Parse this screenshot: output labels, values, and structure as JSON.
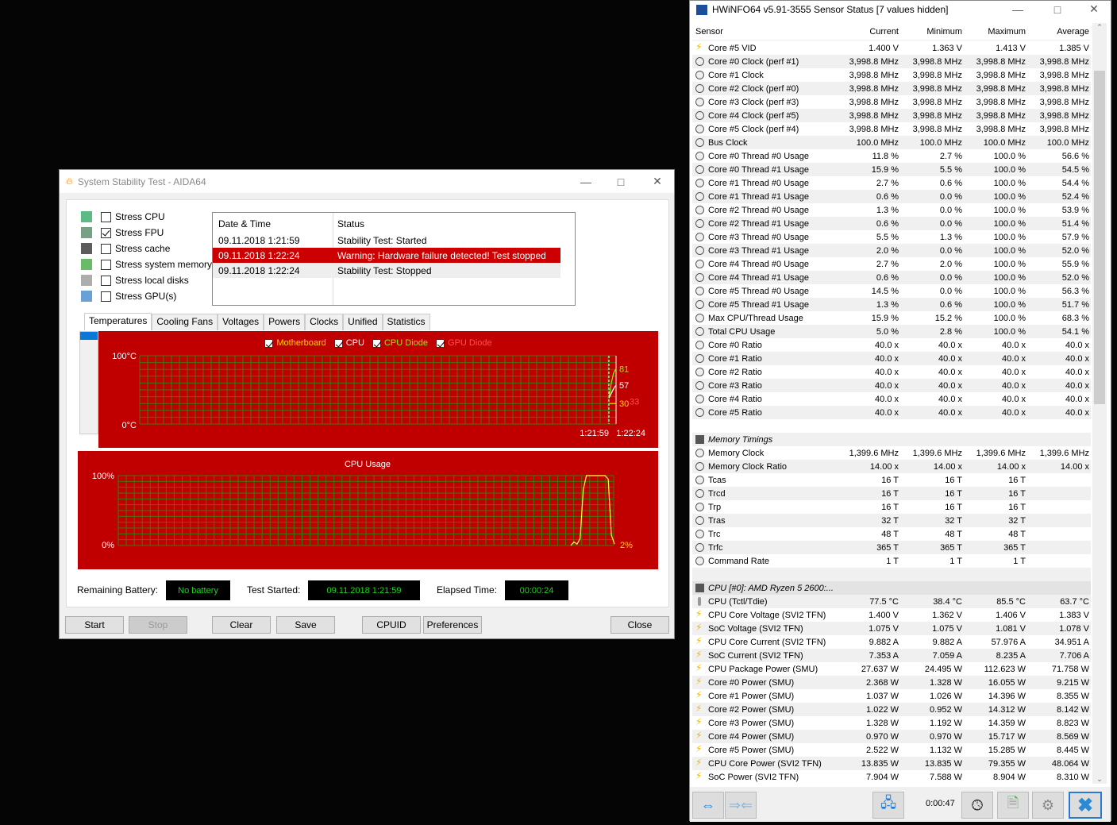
{
  "aida": {
    "title": "System Stability Test - AIDA64",
    "options": [
      {
        "label": "Stress CPU",
        "checked": false
      },
      {
        "label": "Stress FPU",
        "checked": true
      },
      {
        "label": "Stress cache",
        "checked": false
      },
      {
        "label": "Stress system memory",
        "checked": false
      },
      {
        "label": "Stress local disks",
        "checked": false
      },
      {
        "label": "Stress GPU(s)",
        "checked": false
      }
    ],
    "log": {
      "headers": [
        "Date & Time",
        "Status"
      ],
      "rows": [
        [
          "09.11.2018 1:21:59",
          "Stability Test: Started"
        ],
        [
          "09.11.2018 1:22:24",
          "Warning: Hardware failure detected! Test stopped"
        ],
        [
          "09.11.2018 1:22:24",
          "Stability Test: Stopped"
        ]
      ]
    },
    "tabs": [
      "Temperatures",
      "Cooling Fans",
      "Voltages",
      "Powers",
      "Clocks",
      "Unified",
      "Statistics"
    ],
    "battery_label": "Remaining Battery:",
    "battery_value": "No battery",
    "started_label": "Test Started:",
    "started_value": "09.11.2018 1:21:59",
    "elapsed_label": "Elapsed Time:",
    "elapsed_value": "00:00:24",
    "buttons": [
      "Start",
      "Stop",
      "Clear",
      "Save",
      "CPUID",
      "Preferences",
      "Close"
    ]
  },
  "chart_data": [
    {
      "type": "line",
      "title": "Temperatures",
      "legend": [
        {
          "name": "Motherboard",
          "color": "#ffd700"
        },
        {
          "name": "CPU",
          "color": "#ffffff"
        },
        {
          "name": "CPU Diode",
          "color": "#7cfc00"
        },
        {
          "name": "GPU Diode",
          "color": "#ff5050"
        }
      ],
      "ylim": [
        0,
        100
      ],
      "ytick_labels": [
        "100°C",
        "0°C"
      ],
      "xtick_labels": [
        "1:21:59",
        "1:22:24"
      ],
      "value_labels": [
        {
          "text": "81",
          "value": 81,
          "color": "#7cfc00"
        },
        {
          "text": "57",
          "value": 57,
          "color": "#ffffff"
        },
        {
          "text": "30",
          "value": 30,
          "color": "#ffd700"
        },
        {
          "text": "33",
          "value": 33,
          "color": "#ff5050"
        }
      ],
      "series": [
        {
          "name": "CPU Diode",
          "values": [
            38,
            60,
            75,
            81
          ]
        },
        {
          "name": "CPU",
          "values": [
            38,
            45,
            52,
            57
          ]
        },
        {
          "name": "Motherboard",
          "values": [
            30,
            30,
            30,
            30
          ]
        }
      ]
    },
    {
      "type": "line",
      "title": "CPU Usage",
      "ylim": [
        0,
        100
      ],
      "ytick_labels": [
        "100%",
        "0%"
      ],
      "value_label": "2%",
      "series": [
        {
          "name": "CPU Usage",
          "values": [
            0,
            5,
            2,
            10,
            80,
            100,
            100,
            100,
            100,
            100,
            100,
            100,
            95,
            15,
            2
          ]
        }
      ]
    }
  ],
  "hw": {
    "title": "HWiNFO64 v5.91-3555 Sensor Status [7 values hidden]",
    "headers": [
      "Sensor",
      "Current",
      "Minimum",
      "Maximum",
      "Average"
    ],
    "rows": [
      [
        "bolt",
        "Core #5 VID",
        "1.400 V",
        "1.363 V",
        "1.413 V",
        "1.385 V"
      ],
      [
        "clock",
        "Core #0 Clock (perf #1)",
        "3,998.8 MHz",
        "3,998.8 MHz",
        "3,998.8 MHz",
        "3,998.8 MHz"
      ],
      [
        "clock",
        "Core #1 Clock",
        "3,998.8 MHz",
        "3,998.8 MHz",
        "3,998.8 MHz",
        "3,998.8 MHz"
      ],
      [
        "clock",
        "Core #2 Clock (perf #0)",
        "3,998.8 MHz",
        "3,998.8 MHz",
        "3,998.8 MHz",
        "3,998.8 MHz"
      ],
      [
        "clock",
        "Core #3 Clock (perf #3)",
        "3,998.8 MHz",
        "3,998.8 MHz",
        "3,998.8 MHz",
        "3,998.8 MHz"
      ],
      [
        "clock",
        "Core #4 Clock (perf #5)",
        "3,998.8 MHz",
        "3,998.8 MHz",
        "3,998.8 MHz",
        "3,998.8 MHz"
      ],
      [
        "clock",
        "Core #5 Clock (perf #4)",
        "3,998.8 MHz",
        "3,998.8 MHz",
        "3,998.8 MHz",
        "3,998.8 MHz"
      ],
      [
        "clock",
        "Bus Clock",
        "100.0 MHz",
        "100.0 MHz",
        "100.0 MHz",
        "100.0 MHz"
      ],
      [
        "clock",
        "Core #0 Thread #0 Usage",
        "11.8 %",
        "2.7 %",
        "100.0 %",
        "56.6 %"
      ],
      [
        "clock",
        "Core #0 Thread #1 Usage",
        "15.9 %",
        "5.5 %",
        "100.0 %",
        "54.5 %"
      ],
      [
        "clock",
        "Core #1 Thread #0 Usage",
        "2.7 %",
        "0.6 %",
        "100.0 %",
        "54.4 %"
      ],
      [
        "clock",
        "Core #1 Thread #1 Usage",
        "0.6 %",
        "0.0 %",
        "100.0 %",
        "52.4 %"
      ],
      [
        "clock",
        "Core #2 Thread #0 Usage",
        "1.3 %",
        "0.0 %",
        "100.0 %",
        "53.9 %"
      ],
      [
        "clock",
        "Core #2 Thread #1 Usage",
        "0.6 %",
        "0.0 %",
        "100.0 %",
        "51.4 %"
      ],
      [
        "clock",
        "Core #3 Thread #0 Usage",
        "5.5 %",
        "1.3 %",
        "100.0 %",
        "57.9 %"
      ],
      [
        "clock",
        "Core #3 Thread #1 Usage",
        "2.0 %",
        "0.0 %",
        "100.0 %",
        "52.0 %"
      ],
      [
        "clock",
        "Core #4 Thread #0 Usage",
        "2.7 %",
        "2.0 %",
        "100.0 %",
        "55.9 %"
      ],
      [
        "clock",
        "Core #4 Thread #1 Usage",
        "0.6 %",
        "0.0 %",
        "100.0 %",
        "52.0 %"
      ],
      [
        "clock",
        "Core #5 Thread #0 Usage",
        "14.5 %",
        "0.0 %",
        "100.0 %",
        "56.3 %"
      ],
      [
        "clock",
        "Core #5 Thread #1 Usage",
        "1.3 %",
        "0.6 %",
        "100.0 %",
        "51.7 %"
      ],
      [
        "clock",
        "Max CPU/Thread Usage",
        "15.9 %",
        "15.2 %",
        "100.0 %",
        "68.3 %"
      ],
      [
        "clock",
        "Total CPU Usage",
        "5.0 %",
        "2.8 %",
        "100.0 %",
        "54.1 %"
      ],
      [
        "clock",
        "Core #0 Ratio",
        "40.0 x",
        "40.0 x",
        "40.0 x",
        "40.0 x"
      ],
      [
        "clock",
        "Core #1 Ratio",
        "40.0 x",
        "40.0 x",
        "40.0 x",
        "40.0 x"
      ],
      [
        "clock",
        "Core #2 Ratio",
        "40.0 x",
        "40.0 x",
        "40.0 x",
        "40.0 x"
      ],
      [
        "clock",
        "Core #3 Ratio",
        "40.0 x",
        "40.0 x",
        "40.0 x",
        "40.0 x"
      ],
      [
        "clock",
        "Core #4 Ratio",
        "40.0 x",
        "40.0 x",
        "40.0 x",
        "40.0 x"
      ],
      [
        "clock",
        "Core #5 Ratio",
        "40.0 x",
        "40.0 x",
        "40.0 x",
        "40.0 x"
      ],
      [
        "blank",
        "",
        "",
        "",
        "",
        ""
      ],
      [
        "section",
        "Memory Timings",
        "",
        "",
        "",
        ""
      ],
      [
        "clock",
        "Memory Clock",
        "1,399.6 MHz",
        "1,399.6 MHz",
        "1,399.6 MHz",
        "1,399.6 MHz"
      ],
      [
        "clock",
        "Memory Clock Ratio",
        "14.00 x",
        "14.00 x",
        "14.00 x",
        "14.00 x"
      ],
      [
        "clock",
        "Tcas",
        "16 T",
        "16 T",
        "16 T",
        ""
      ],
      [
        "clock",
        "Trcd",
        "16 T",
        "16 T",
        "16 T",
        ""
      ],
      [
        "clock",
        "Trp",
        "16 T",
        "16 T",
        "16 T",
        ""
      ],
      [
        "clock",
        "Tras",
        "32 T",
        "32 T",
        "32 T",
        ""
      ],
      [
        "clock",
        "Trc",
        "48 T",
        "48 T",
        "48 T",
        ""
      ],
      [
        "clock",
        "Trfc",
        "365 T",
        "365 T",
        "365 T",
        ""
      ],
      [
        "clock",
        "Command Rate",
        "1 T",
        "1 T",
        "1 T",
        ""
      ],
      [
        "blank",
        "",
        "",
        "",
        "",
        ""
      ],
      [
        "section",
        "CPU [#0]: AMD Ryzen 5 2600:...",
        "",
        "",
        "",
        ""
      ],
      [
        "thermo",
        "CPU (Tctl/Tdie)",
        "77.5 °C",
        "38.4 °C",
        "85.5 °C",
        "63.7 °C"
      ],
      [
        "bolt",
        "CPU Core Voltage (SVI2 TFN)",
        "1.400 V",
        "1.362 V",
        "1.406 V",
        "1.383 V"
      ],
      [
        "bolt",
        "SoC Voltage (SVI2 TFN)",
        "1.075 V",
        "1.075 V",
        "1.081 V",
        "1.078 V"
      ],
      [
        "bolt",
        "CPU Core Current (SVI2 TFN)",
        "9.882 A",
        "9.882 A",
        "57.976 A",
        "34.951 A"
      ],
      [
        "bolt",
        "SoC Current (SVI2 TFN)",
        "7.353 A",
        "7.059 A",
        "8.235 A",
        "7.706 A"
      ],
      [
        "bolt",
        "CPU Package Power (SMU)",
        "27.637 W",
        "24.495 W",
        "112.623 W",
        "71.758 W"
      ],
      [
        "bolt",
        "Core #0 Power (SMU)",
        "2.368 W",
        "1.328 W",
        "16.055 W",
        "9.215 W"
      ],
      [
        "bolt",
        "Core #1 Power (SMU)",
        "1.037 W",
        "1.026 W",
        "14.396 W",
        "8.355 W"
      ],
      [
        "bolt",
        "Core #2 Power (SMU)",
        "1.022 W",
        "0.952 W",
        "14.312 W",
        "8.142 W"
      ],
      [
        "bolt",
        "Core #3 Power (SMU)",
        "1.328 W",
        "1.192 W",
        "14.359 W",
        "8.823 W"
      ],
      [
        "bolt",
        "Core #4 Power (SMU)",
        "0.970 W",
        "0.970 W",
        "15.717 W",
        "8.569 W"
      ],
      [
        "bolt",
        "Core #5 Power (SMU)",
        "2.522 W",
        "1.132 W",
        "15.285 W",
        "8.445 W"
      ],
      [
        "bolt",
        "CPU Core Power (SVI2 TFN)",
        "13.835 W",
        "13.835 W",
        "79.355 W",
        "48.064 W"
      ],
      [
        "bolt",
        "SoC Power (SVI2 TFN)",
        "7.904 W",
        "7.588 W",
        "8.904 W",
        "8.310 W"
      ]
    ],
    "timer": "0:00:47"
  }
}
